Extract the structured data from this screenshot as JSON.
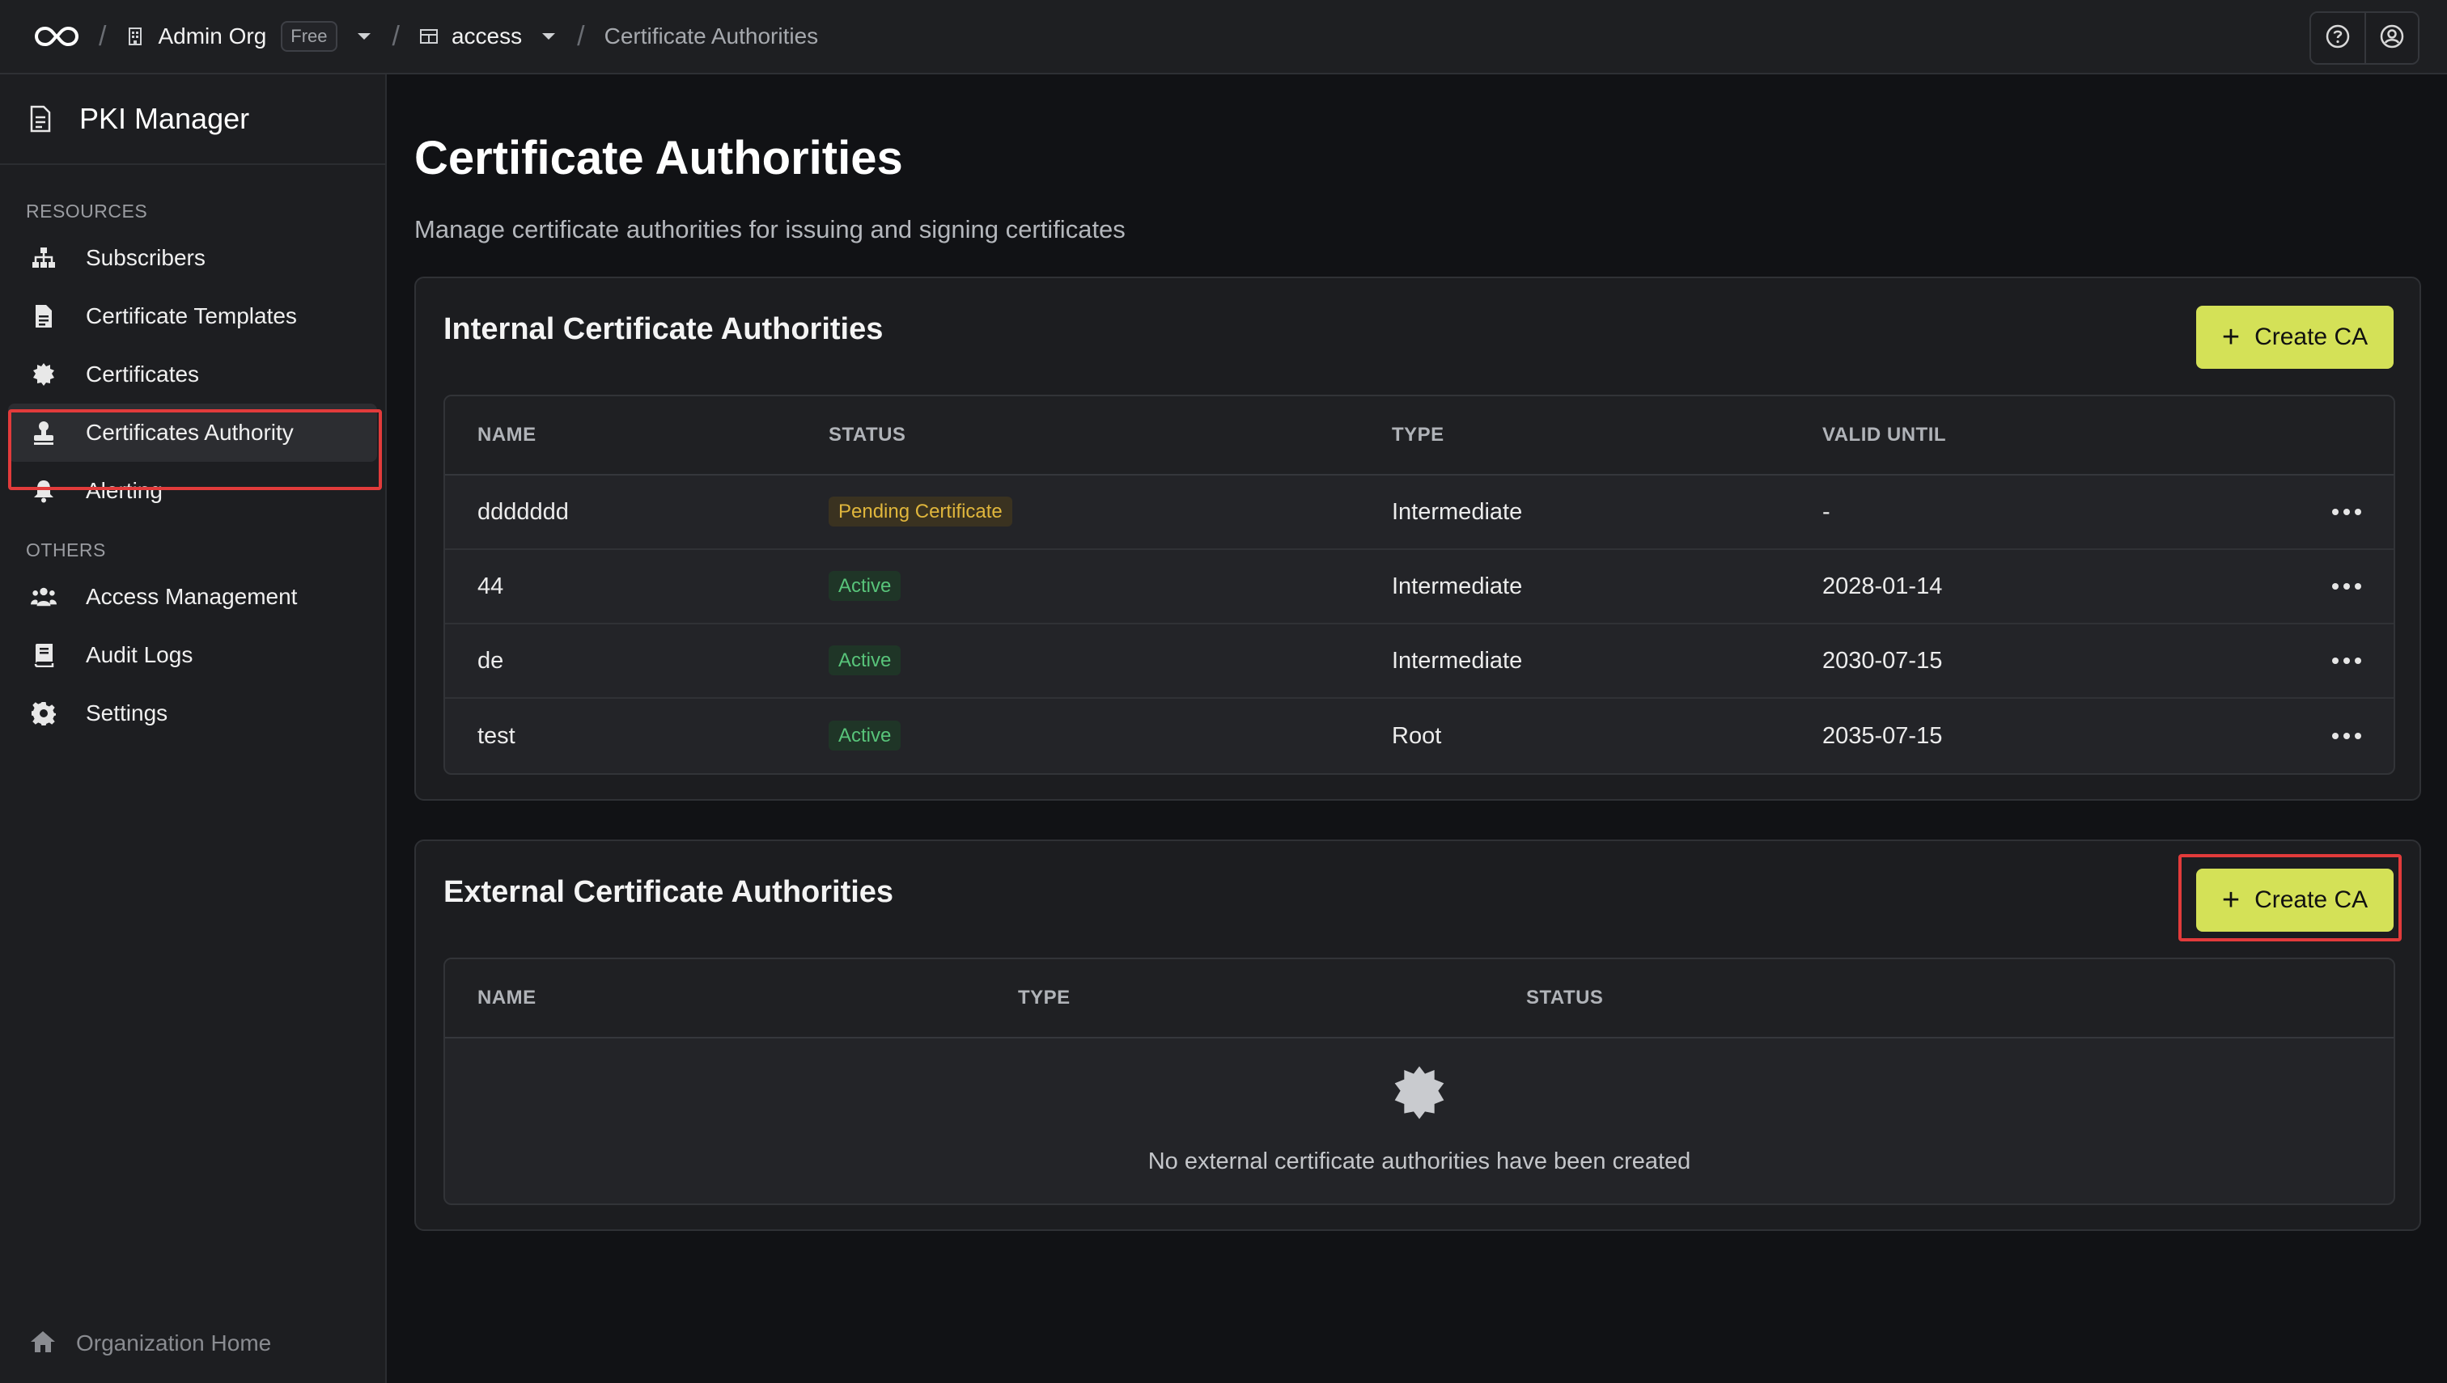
{
  "topbar": {
    "org_name": "Admin Org",
    "plan_badge": "Free",
    "project_name": "access",
    "current_page": "Certificate Authorities"
  },
  "sidebar": {
    "title": "PKI Manager",
    "sections": [
      {
        "label": "RESOURCES",
        "items": [
          {
            "label": "Subscribers",
            "icon": "sitemap-icon"
          },
          {
            "label": "Certificate Templates",
            "icon": "file-icon"
          },
          {
            "label": "Certificates",
            "icon": "certificate-icon"
          },
          {
            "label": "Certificates Authority",
            "icon": "stamp-icon",
            "active": true
          },
          {
            "label": "Alerting",
            "icon": "bell-icon"
          }
        ]
      },
      {
        "label": "OTHERS",
        "items": [
          {
            "label": "Access Management",
            "icon": "users-icon"
          },
          {
            "label": "Audit Logs",
            "icon": "book-icon"
          },
          {
            "label": "Settings",
            "icon": "gear-icon"
          }
        ]
      }
    ],
    "footer_label": "Organization Home"
  },
  "page": {
    "title": "Certificate Authorities",
    "subtitle": "Manage certificate authorities for issuing and signing certificates"
  },
  "internal": {
    "title": "Internal Certificate Authorities",
    "create_label": "Create CA",
    "columns": [
      "NAME",
      "STATUS",
      "TYPE",
      "VALID UNTIL"
    ],
    "rows": [
      {
        "name": "ddddddd",
        "status": "Pending Certificate",
        "status_kind": "pending",
        "type": "Intermediate",
        "valid_until": "-"
      },
      {
        "name": "44",
        "status": "Active",
        "status_kind": "active",
        "type": "Intermediate",
        "valid_until": "2028-01-14"
      },
      {
        "name": "de",
        "status": "Active",
        "status_kind": "active",
        "type": "Intermediate",
        "valid_until": "2030-07-15"
      },
      {
        "name": "test",
        "status": "Active",
        "status_kind": "active",
        "type": "Root",
        "valid_until": "2035-07-15"
      }
    ]
  },
  "external": {
    "title": "External Certificate Authorities",
    "create_label": "Create CA",
    "columns": [
      "NAME",
      "TYPE",
      "STATUS"
    ],
    "empty_message": "No external certificate authorities have been created"
  },
  "colors": {
    "accent": "#d4e157",
    "highlight": "#e23b3b",
    "pending": "#e0b63c",
    "active": "#58c47a"
  }
}
